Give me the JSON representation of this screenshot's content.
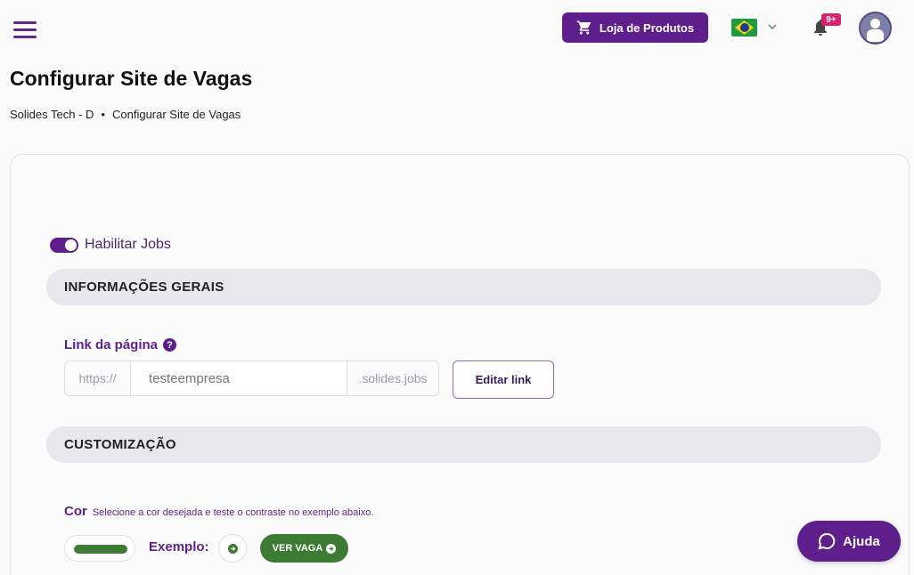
{
  "header": {
    "store_button_label": "Loja de Produtos",
    "notification_badge": "9+"
  },
  "page": {
    "title": "Configurar Site de Vagas",
    "breadcrumb": [
      "Solides Tech - D",
      "•",
      "Configurar Site de Vagas"
    ]
  },
  "jobs_toggle": {
    "label": "Habilitar Jobs",
    "enabled": true
  },
  "sections": {
    "general": "INFORMAÇÕES GERAIS",
    "customization": "CUSTOMIZAÇÃO"
  },
  "link": {
    "label": "Link da página",
    "help": "?",
    "prefix": "https://",
    "placeholder": "testeempresa",
    "suffix": ".solides.jobs",
    "edit_label": "Editar link"
  },
  "color": {
    "label": "Cor",
    "hint": "Selecione a cor desejada e teste o contraste no exemplo abaixo.",
    "value": "#3d7a33",
    "example_label": "Exemplo:",
    "view_button_label": "VER VAGA"
  },
  "help_fab": {
    "label": "Ajuda"
  },
  "icons": {
    "menu": "hamburger-icon",
    "cart": "cart-icon",
    "flag": "brazil-flag-icon",
    "chevron": "chevron-down-icon",
    "bell": "bell-icon",
    "avatar": "user-avatar-icon",
    "chat": "chat-bubble-icon"
  },
  "colors": {
    "brand": "#5e1f8c",
    "accent_green": "#3d7a33",
    "badge": "#d9226f"
  }
}
